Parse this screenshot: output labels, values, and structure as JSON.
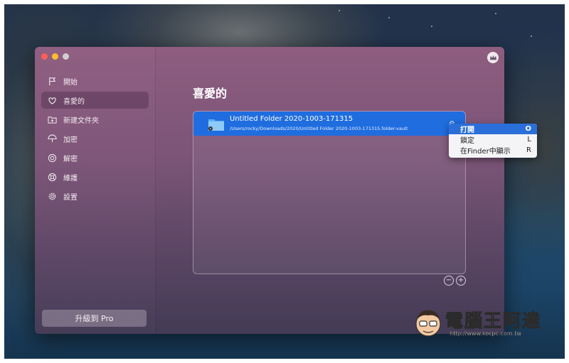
{
  "window": {
    "title": ""
  },
  "sidebar": {
    "items": [
      {
        "label": "開始",
        "icon": "flag-icon",
        "active": false
      },
      {
        "label": "喜愛的",
        "icon": "heart-icon",
        "active": true
      },
      {
        "label": "新建文件夾",
        "icon": "new-folder-icon",
        "active": false
      },
      {
        "label": "加密",
        "icon": "umbrella-icon",
        "active": false
      },
      {
        "label": "解密",
        "icon": "unlock-dial-icon",
        "active": false
      },
      {
        "label": "維護",
        "icon": "lifebuoy-icon",
        "active": false
      },
      {
        "label": "設置",
        "icon": "gear-icon",
        "active": false
      }
    ],
    "upgrade_label": "升級到 Pro"
  },
  "main": {
    "title": "喜愛的",
    "favorites": [
      {
        "name": "Untitled Folder 2020-1003-171315",
        "path": "/Users/rocky/Downloads/2020/Untitled Folder 2020-1003-171315.folder-vault",
        "selected": true
      }
    ]
  },
  "context_menu": {
    "items": [
      {
        "label": "打開",
        "shortcut": "O",
        "active": true
      },
      {
        "label": "鎖定",
        "shortcut": "L",
        "active": false
      },
      {
        "label": "在Finder中顯示",
        "shortcut": "R",
        "active": false
      }
    ]
  },
  "list_controls": {
    "remove_symbol": "−",
    "add_symbol": "+"
  },
  "watermark": {
    "text": "電腦王阿達",
    "url": "http://www.kocpc.com.tw"
  },
  "colors": {
    "accent": "#1f6ddf",
    "menu_highlight": "#2a6fd9",
    "window_top": "#8e5d7f",
    "window_bottom": "#433b55"
  }
}
